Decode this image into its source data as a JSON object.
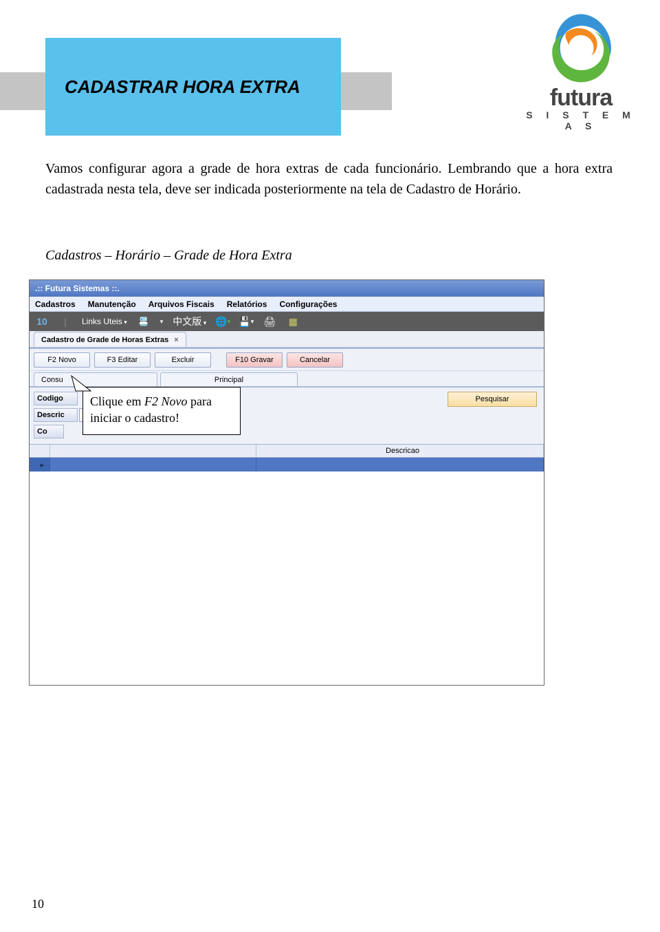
{
  "header": {
    "title": "CADASTRAR HORA EXTRA"
  },
  "logo": {
    "brand": "futura",
    "tagline": "S I S T E M A S"
  },
  "paragraph": "Vamos configurar agora a grade de hora extras de cada funcionário. Lembrando que a hora extra cadastrada nesta tela, deve ser indicada posteriormente na tela de Cadastro de Horário.",
  "breadcrumb": "Cadastros – Horário – Grade de Hora Extra",
  "app": {
    "title": ".:: Futura Sistemas ::.",
    "menu": [
      "Cadastros",
      "Manutenção",
      "Arquivos Fiscais",
      "Relatórios",
      "Configurações"
    ],
    "toolbar": {
      "links_uteis": "Links Uteis",
      "cn": "中文版"
    },
    "tab_label": "Cadastro de Grade de Horas Extras",
    "buttons": {
      "novo": "F2 Novo",
      "editar": "F3 Editar",
      "excluir": "Excluir",
      "gravar": "F10 Gravar",
      "cancelar": "Cancelar"
    },
    "subtabs": {
      "consulta": "Consu",
      "principal": "Principal"
    },
    "filters": {
      "codigo_label": "Codigo",
      "descricao_label": "Descric",
      "co_label": "Co",
      "pesquisar": "Pesquisar"
    },
    "grid_headers": {
      "arrow": "",
      "col2": "",
      "descricao": "Descricao"
    }
  },
  "callout": {
    "line1_a": "Clique em ",
    "line1_b": "F2 Novo",
    "line1_c": " para",
    "line2": "iniciar o cadastro!"
  },
  "page_number": "10"
}
